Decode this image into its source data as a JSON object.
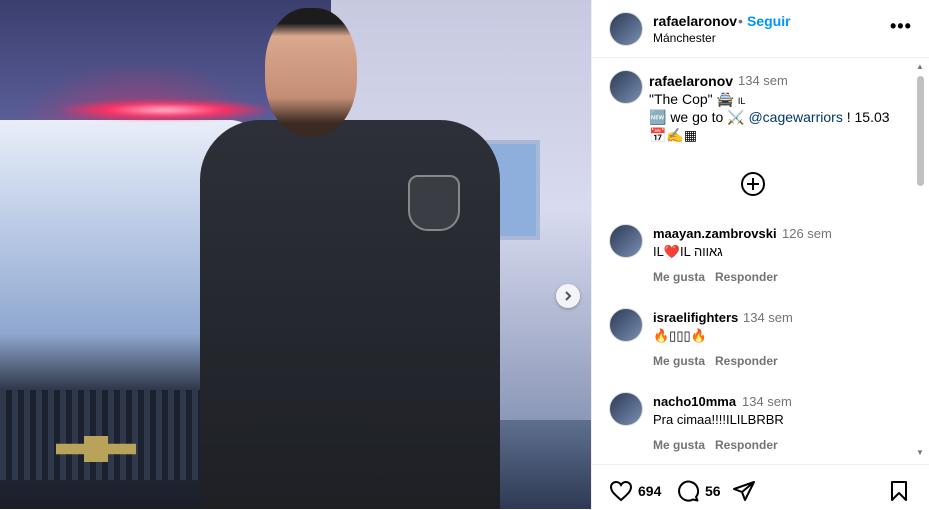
{
  "post": {
    "username": "rafaelaronov",
    "follow_label": "Seguir",
    "separator": "•",
    "location": "Mánchester",
    "more_label": "•••",
    "next_media_label": "›"
  },
  "caption": {
    "username": "rafaelaronov",
    "time": "134 sem",
    "line1": "\"The Cop\" 🚔",
    "line1_flag": "IL",
    "line2_prefix": "🆕 we go to ⚔️",
    "mention": "@cagewarriors",
    "line2_suffix": "! 15.03",
    "line3": "📅✍️▦"
  },
  "comments": [
    {
      "username": "maayan.zambrovski",
      "time": "126 sem",
      "text": "IL❤️IL גאווה",
      "like_label": "Me gusta",
      "reply_label": "Responder"
    },
    {
      "username": "israelifighters",
      "time": "134 sem",
      "text": "🔥▯▯▯🔥",
      "like_label": "Me gusta",
      "reply_label": "Responder"
    },
    {
      "username": "nacho10mma",
      "time": "134 sem",
      "text": "Pra cimaa!!!!ILILBRBR",
      "like_label": "Me gusta",
      "reply_label": "Responder"
    }
  ],
  "footer": {
    "likes": "694",
    "comments": "56"
  },
  "icons": {
    "like": "heart-icon",
    "comment": "comment-icon",
    "share": "paper-plane-icon",
    "save": "bookmark-icon",
    "add": "plus-circle-icon",
    "next": "chevron-right-icon"
  },
  "colors": {
    "follow": "#0095f6",
    "mention": "#00376b",
    "muted": "#737373"
  }
}
